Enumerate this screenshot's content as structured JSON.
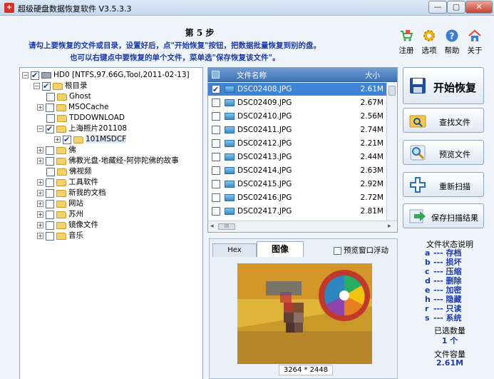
{
  "window": {
    "title": "超级硬盘数据恢复软件 V3.5.3.3",
    "controls": [
      "—",
      "▢",
      "✕"
    ]
  },
  "header": {
    "step": "第 5 步",
    "line1": "请勾上要恢复的文件或目录，设置好后，点\"开始恢复\"按钮，把数据批量恢复到别的盘。",
    "line2": "也可以右键点中要恢复的单个文件，菜单选\"保存恢复该文件\"。"
  },
  "top_icons": [
    {
      "label": "注册",
      "icon": "cart-icon",
      "color": "#3fa64a"
    },
    {
      "label": "选项",
      "icon": "gear-icon",
      "color": "#f2b316"
    },
    {
      "label": "帮助",
      "icon": "help-icon",
      "color": "#3e7fd2"
    },
    {
      "label": "关于",
      "icon": "home-icon",
      "color": "#e0563a"
    }
  ],
  "tree": {
    "drive": "HD0 [NTFS,97.66G,Tool,2011-02-13]",
    "root": "根目录",
    "items": [
      {
        "label": "Ghost",
        "checked": false,
        "expander": false
      },
      {
        "label": "MSOCache",
        "checked": false,
        "expander": true
      },
      {
        "label": "TDDOWNLOAD",
        "checked": false,
        "expander": false
      },
      {
        "label": "上海照片201108",
        "checked": true,
        "expander": true
      },
      {
        "label": "101MSDCF",
        "checked": true,
        "expander": true,
        "child": true
      },
      {
        "label": "佛",
        "checked": false,
        "expander": true
      },
      {
        "label": "佛教光盘-地藏经-阿弥陀佛的故事",
        "checked": false,
        "expander": true
      },
      {
        "label": "佛视频",
        "checked": false,
        "expander": false
      },
      {
        "label": "工具软件",
        "checked": false,
        "expander": true
      },
      {
        "label": "新我的文档",
        "checked": false,
        "expander": true
      },
      {
        "label": "网站",
        "checked": false,
        "expander": true
      },
      {
        "label": "苏州",
        "checked": false,
        "expander": true
      },
      {
        "label": "镜像文件",
        "checked": false,
        "expander": true
      },
      {
        "label": "音乐",
        "checked": false,
        "expander": true
      }
    ]
  },
  "file_list": {
    "col_name": "文件名称",
    "col_size": "大小",
    "files": [
      {
        "name": "DSC02408.JPG",
        "size": "2.61M",
        "checked": true,
        "selected": true
      },
      {
        "name": "DSC02409.JPG",
        "size": "2.67M",
        "checked": false
      },
      {
        "name": "DSC02410.JPG",
        "size": "2.56M",
        "checked": false
      },
      {
        "name": "DSC02411.JPG",
        "size": "2.74M",
        "checked": false
      },
      {
        "name": "DSC02412.JPG",
        "size": "2.21M",
        "checked": false
      },
      {
        "name": "DSC02413.JPG",
        "size": "2.44M",
        "checked": false
      },
      {
        "name": "DSC02414.JPG",
        "size": "2.63M",
        "checked": false
      },
      {
        "name": "DSC02415.JPG",
        "size": "2.92M",
        "checked": false
      },
      {
        "name": "DSC02416.JPG",
        "size": "2.72M",
        "checked": false
      },
      {
        "name": "DSC02417.JPG",
        "size": "2.81M",
        "checked": false
      }
    ],
    "hscroll_thumb": "III"
  },
  "preview": {
    "tab_hex": "Hex",
    "tab_image": "图像",
    "float_label": "预览窗口浮动",
    "dimensions": "3264 * 2448"
  },
  "actions": {
    "start": "开始恢复",
    "find": "查找文件",
    "preview": "预览文件",
    "rescan": "重新扫描",
    "save_scan": "保存扫描结果"
  },
  "status_legend": {
    "title": "文件状态说明",
    "rows": [
      {
        "key": "a",
        "desc": "--- 存档"
      },
      {
        "key": "b",
        "desc": "--- 损坏"
      },
      {
        "key": "c",
        "desc": "--- 压缩"
      },
      {
        "key": "d",
        "desc": "--- 删除"
      },
      {
        "key": "e",
        "desc": "--- 加密"
      },
      {
        "key": "h",
        "desc": "--- 隐藏"
      },
      {
        "key": "r",
        "desc": "--- 只读"
      },
      {
        "key": "s",
        "desc": "--- 系统"
      }
    ],
    "selected_label": "已选数量",
    "selected_value": "1 个",
    "size_label": "文件容量",
    "size_value": "2.61M"
  }
}
